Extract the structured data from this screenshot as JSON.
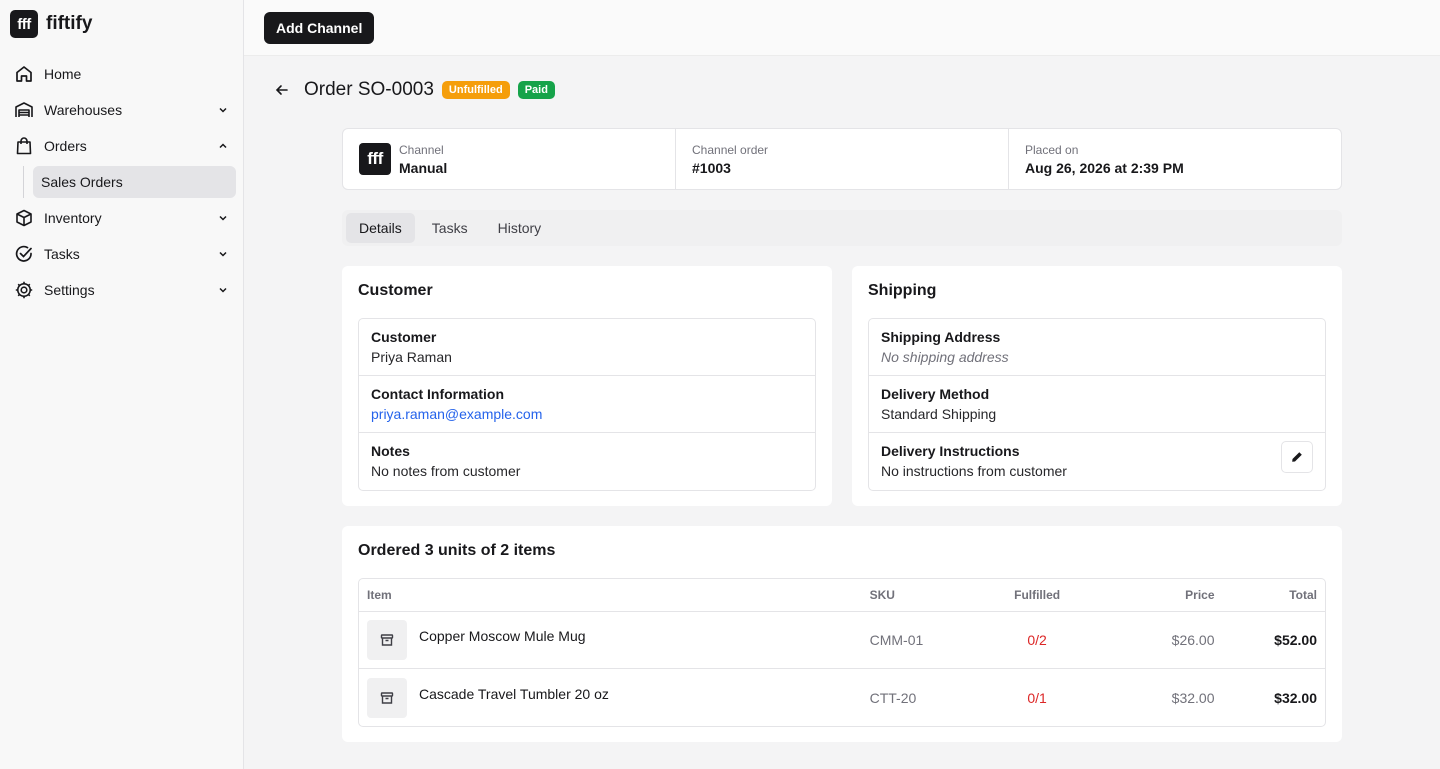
{
  "brand": {
    "logo_text": "fff",
    "name": "fiftify"
  },
  "sidebar": {
    "items": [
      {
        "label": "Home",
        "icon": "home-icon"
      },
      {
        "label": "Warehouses",
        "icon": "warehouse-icon"
      },
      {
        "label": "Orders",
        "icon": "shopping-bag-icon"
      },
      {
        "label": "Sales Orders"
      },
      {
        "label": "Inventory",
        "icon": "box-icon"
      },
      {
        "label": "Tasks",
        "icon": "check-circle-icon"
      },
      {
        "label": "Settings",
        "icon": "gear-icon"
      }
    ]
  },
  "topbar": {
    "add_channel_label": "Add Channel"
  },
  "order": {
    "title": "Order SO-0003",
    "badges": {
      "fulfillment": "Unfulfilled",
      "payment": "Paid"
    },
    "info": {
      "channel_label": "Channel",
      "channel_value": "Manual",
      "channel_logo": "fff",
      "channel_order_label": "Channel order",
      "channel_order_value": "#1003",
      "placed_label": "Placed on",
      "placed_value": "Aug 26, 2026 at 2:39 PM"
    },
    "tabs": [
      "Details",
      "Tasks",
      "History"
    ]
  },
  "customer": {
    "title": "Customer",
    "customer_label": "Customer",
    "customer_value": "Priya Raman",
    "contact_label": "Contact Information",
    "contact_value": "priya.raman@example.com",
    "notes_label": "Notes",
    "notes_value": "No notes from customer"
  },
  "shipping": {
    "title": "Shipping",
    "address_label": "Shipping Address",
    "address_value": "No shipping address",
    "method_label": "Delivery Method",
    "method_value": "Standard Shipping",
    "instructions_label": "Delivery Instructions",
    "instructions_value": "No instructions from customer"
  },
  "items": {
    "title": "Ordered 3 units of 2 items",
    "columns": {
      "item": "Item",
      "sku": "SKU",
      "fulfilled": "Fulfilled",
      "price": "Price",
      "total": "Total"
    },
    "rows": [
      {
        "name": "Copper Moscow Mule Mug",
        "sku": "CMM-01",
        "fulfilled": "0/2",
        "price": "$26.00",
        "total": "$52.00"
      },
      {
        "name": "Cascade Travel Tumbler 20 oz",
        "sku": "CTT-20",
        "fulfilled": "0/1",
        "price": "$32.00",
        "total": "$32.00"
      }
    ]
  },
  "colors": {
    "accent": "#18181b",
    "unfulfilled": "#f59e0b",
    "paid": "#16a34a",
    "link": "#2563eb",
    "fulfilled_text": "#dc2626"
  }
}
